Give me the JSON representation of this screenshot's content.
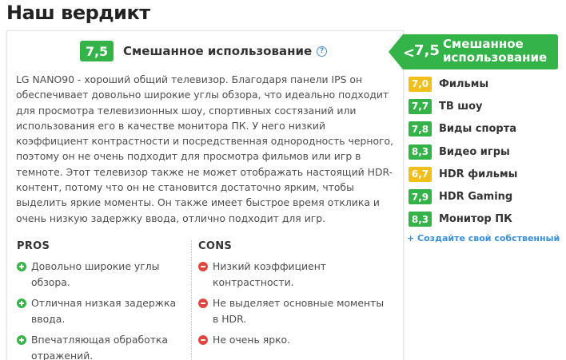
{
  "page_title": "Наш вердикт",
  "verdict": {
    "score": "7,5",
    "score_color": "#34b349",
    "label": "Смешанное использование",
    "help_icon": "?",
    "text": "LG NANO90 - хороший общий телевизор. Благодаря панели IPS он обеспечивает довольно широкие углы обзора, что идеально подходит для просмотра телевизионных шоу, спортивных состязаний или использования его в качестве монитора ПК. У него низкий коэффициент контрастности и посредственная однородность черного, поэтому он не очень подходит для просмотра фильмов или игр в темноте. Этот телевизор также не может отображать настоящий HDR-контент, потому что он не становится достаточно ярким, чтобы выделить яркие моменты. Он также имеет быстрое время отклика и очень низкую задержку ввода, отлично подходит для игр."
  },
  "pros": {
    "title": "PROS",
    "icon": "plus-circle-icon",
    "items": [
      "Довольно широкие углы обзора.",
      "Отличная низкая задержка ввода.",
      "Впечатляющая обработка отражений."
    ]
  },
  "cons": {
    "title": "CONS",
    "icon": "minus-circle-icon",
    "items": [
      "Низкий коэффициент контрастности.",
      "Не выделяет основные моменты в HDR.",
      "Не очень ярко."
    ]
  },
  "sidebar": {
    "active": {
      "score": "7,5",
      "label": "Смешанное использование",
      "color": "#34b349",
      "chevron": "<"
    },
    "items": [
      {
        "score": "7,0",
        "label": "Фильмы",
        "color": "#f2be18"
      },
      {
        "score": "7,7",
        "label": "ТВ шоу",
        "color": "#34b349"
      },
      {
        "score": "7,8",
        "label": "Виды спорта",
        "color": "#34b349"
      },
      {
        "score": "8,3",
        "label": "Видео игры",
        "color": "#34b349"
      },
      {
        "score": "6,7",
        "label": "HDR фильмы",
        "color": "#f2be18"
      },
      {
        "score": "7,9",
        "label": "HDR Gaming",
        "color": "#34b349"
      },
      {
        "score": "8,3",
        "label": "Монитор ПК",
        "color": "#34b349"
      }
    ],
    "create_link": "+ Создайте свой собственный"
  }
}
